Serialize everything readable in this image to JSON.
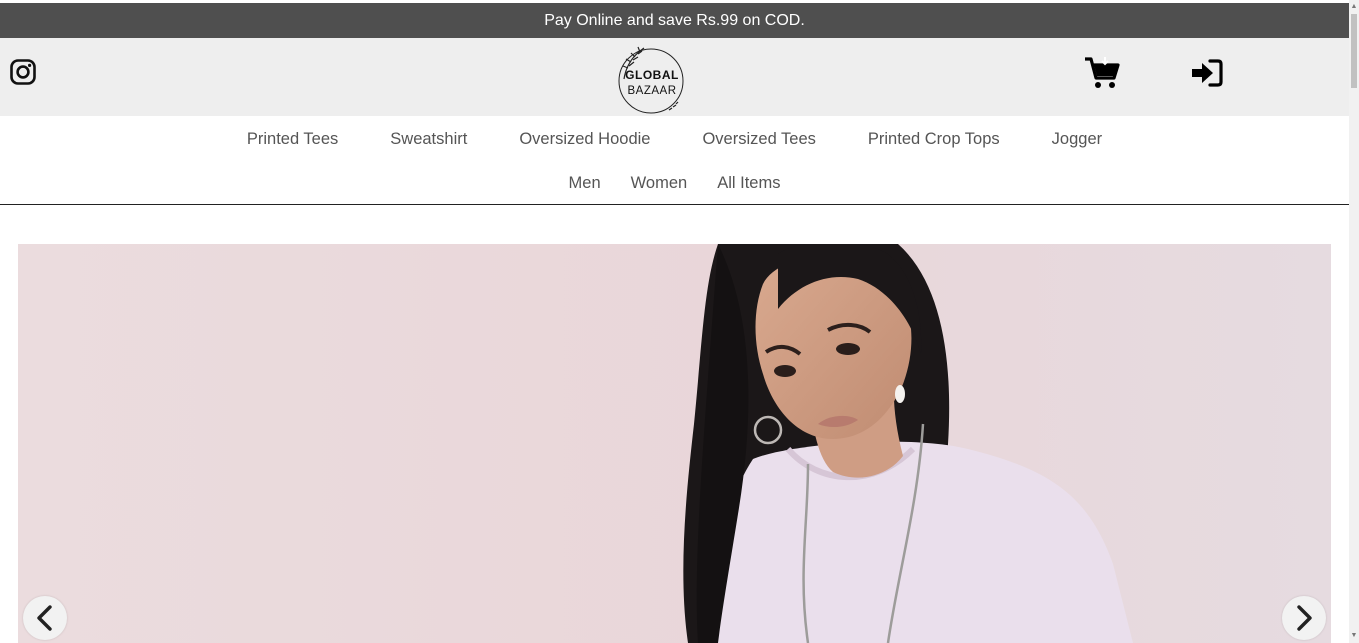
{
  "announcement": {
    "text": "Pay Online and save Rs.99 on COD."
  },
  "header": {
    "logo": {
      "line1": "GLOBAL",
      "line2": "BAZAAR"
    },
    "icons": [
      "instagram-icon",
      "shopping-cart-icon",
      "sign-in-icon"
    ]
  },
  "nav": {
    "row1": [
      {
        "label": "Printed Tees"
      },
      {
        "label": "Sweatshirt"
      },
      {
        "label": "Oversized Hoodie"
      },
      {
        "label": "Oversized Tees"
      },
      {
        "label": "Printed Crop Tops"
      },
      {
        "label": "Jogger"
      }
    ],
    "row2": [
      {
        "label": "Men"
      },
      {
        "label": "Women"
      },
      {
        "label": "All Items"
      }
    ]
  },
  "carousel": {
    "controls": [
      "chevron-left-icon",
      "chevron-right-icon"
    ]
  },
  "colors": {
    "announcement_bg": "#4f4f4f",
    "header_bg": "#eeeeee",
    "hero_bg": "#eadbdd",
    "text": "#555555"
  }
}
